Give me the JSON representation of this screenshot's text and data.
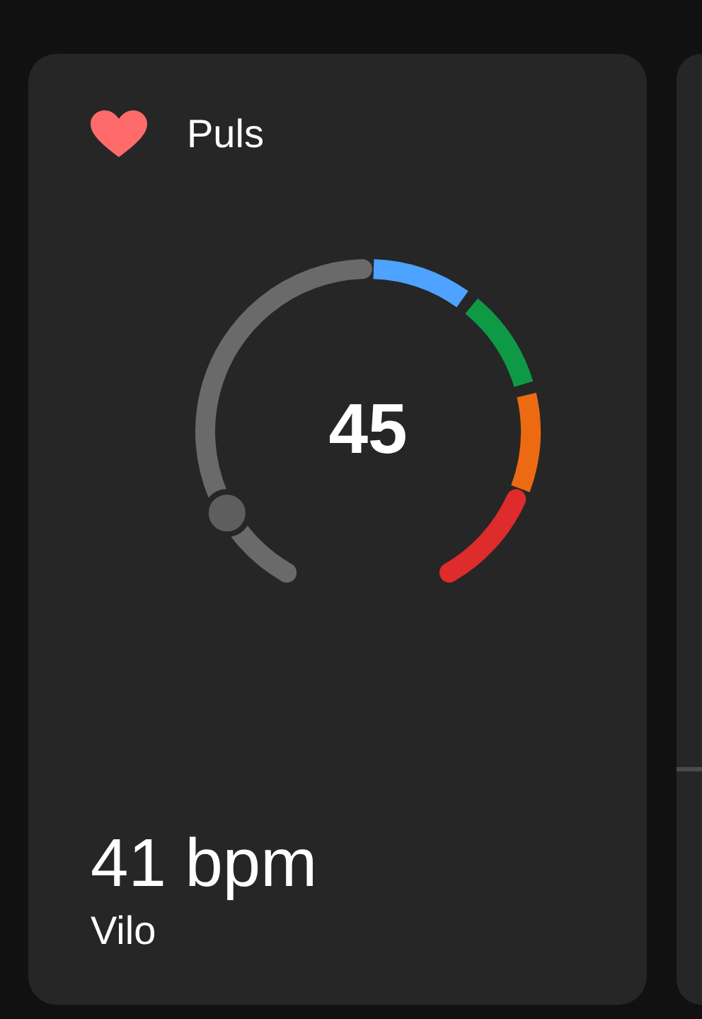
{
  "card": {
    "title": "Puls",
    "gauge": {
      "value": "45",
      "zones": [
        {
          "color": "#6a6a6a"
        },
        {
          "color": "#4da3ff"
        },
        {
          "color": "#0e9a45"
        },
        {
          "color": "#ec6a12"
        },
        {
          "color": "#de2b2b"
        }
      ]
    },
    "reading": "41 bpm",
    "label": "Vilo"
  }
}
